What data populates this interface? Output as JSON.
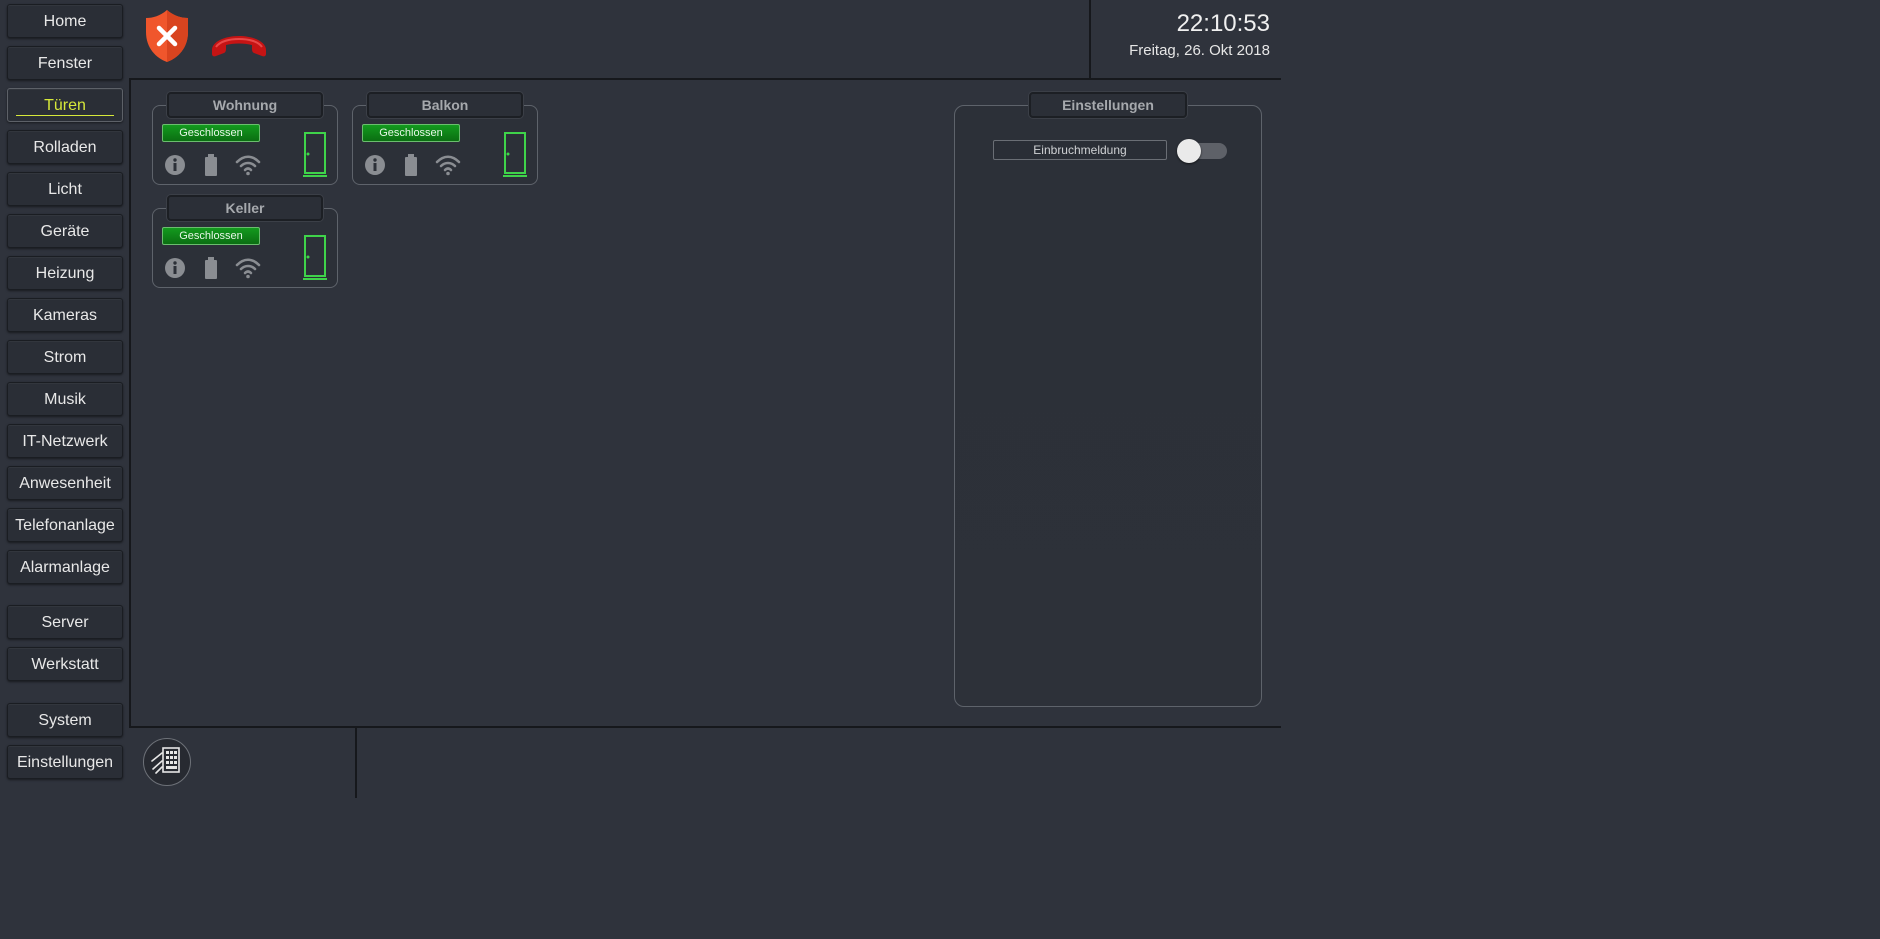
{
  "header": {
    "time": "22:10:53",
    "date": "Freitag, 26. Okt 2018",
    "alarm_icon": "shield-x-icon",
    "phone_icon": "phone-hangup-icon"
  },
  "sidebar": {
    "items": [
      {
        "label": "Home"
      },
      {
        "label": "Fenster"
      },
      {
        "label": "Türen",
        "active": true
      },
      {
        "label": "Rolladen"
      },
      {
        "label": "Licht"
      },
      {
        "label": "Geräte"
      },
      {
        "label": "Heizung"
      },
      {
        "label": "Kameras"
      },
      {
        "label": "Strom"
      },
      {
        "label": "Musik"
      },
      {
        "label": "IT-Netzwerk"
      },
      {
        "label": "Anwesenheit"
      },
      {
        "label": "Telefonanlage"
      },
      {
        "label": "Alarmanlage"
      },
      {
        "label": "Server"
      },
      {
        "label": "Werkstatt"
      },
      {
        "label": "System"
      },
      {
        "label": "Einstellungen"
      }
    ],
    "active_color": "#d6e83a"
  },
  "doors": [
    {
      "title": "Wohnung",
      "status": "Geschlossen"
    },
    {
      "title": "Balkon",
      "status": "Geschlossen"
    },
    {
      "title": "Keller",
      "status": "Geschlossen"
    }
  ],
  "settings_panel": {
    "title": "Einstellungen",
    "items": [
      {
        "label": "Einbruchmeldung",
        "enabled": false
      }
    ]
  },
  "colors": {
    "status_green": "#139a1e",
    "door_green": "#3fd34a",
    "alarm_orange": "#f0562c",
    "phone_red": "#d01818"
  },
  "footer": {
    "icon": "keypad-icon"
  }
}
